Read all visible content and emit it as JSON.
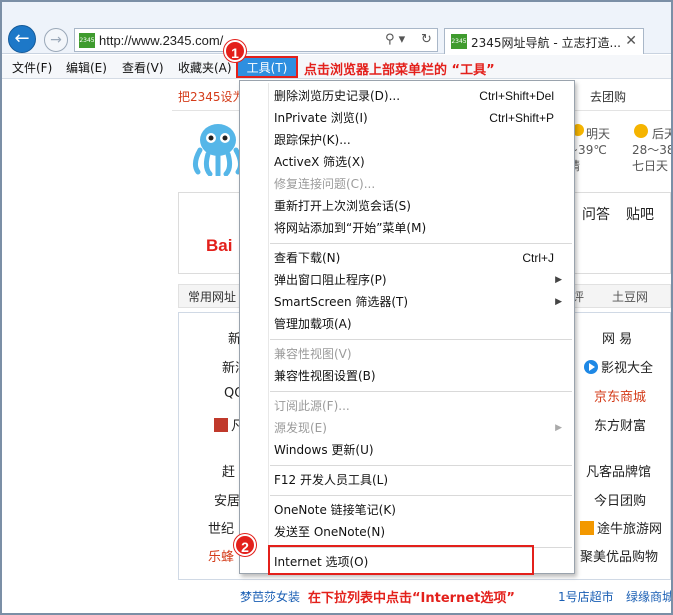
{
  "browser": {
    "url": "http://www.2345.com/",
    "site_icon_text": "2345",
    "url_controls": [
      "⚲ ▾",
      "↻"
    ],
    "tab_title": "2345网址导航 - 立志打造...",
    "tab_close": "✕",
    "back_glyph": "←",
    "forward_glyph": "→"
  },
  "menubar": {
    "file": "文件(F)",
    "edit": "编辑(E)",
    "view": "查看(V)",
    "favorites": "收藏夹(A)",
    "tools": "工具(T)",
    "annotation": "点击浏览器上部菜单栏的 “工具”"
  },
  "badges": {
    "step1": "1",
    "step2": "2"
  },
  "page": {
    "home_link": "把2345设为主页",
    "go_shop": "去团购",
    "weather": {
      "day1": "明天",
      "temp1": "~39℃",
      "cond1": "晴",
      "day2": "后天",
      "temp2": "28～38",
      "cond2": "七日天"
    },
    "baidu": "Bai",
    "search_tabs": {
      "qa": "问答",
      "tieba": "贴吧"
    },
    "category_left": "常用网址",
    "category_right": [
      "评",
      "土豆网"
    ],
    "sites_left": [
      "新",
      "新浪",
      "QQ",
      "凡",
      "赶",
      "安居",
      "世纪",
      "乐蜂"
    ],
    "sites_right": [
      "网 易",
      "影视大全",
      "京东商城",
      "东方财富",
      "凡客品牌馆",
      "今日团购",
      "途牛旅游网",
      "聚美优品购物"
    ],
    "bottom_left": "梦芭莎女装",
    "bottom_annotation": "在下拉列表中点击“Internet选项”",
    "bottom_right": [
      "1号店超市",
      "绿缘商城"
    ]
  },
  "dropdown": {
    "items": [
      {
        "label": "删除浏览历史记录(D)...",
        "shortcut": "Ctrl+Shift+Del",
        "disabled": false
      },
      {
        "label": "InPrivate 浏览(I)",
        "shortcut": "Ctrl+Shift+P",
        "disabled": false
      },
      {
        "label": "跟踪保护(K)...",
        "shortcut": "",
        "disabled": false
      },
      {
        "label": "ActiveX 筛选(X)",
        "shortcut": "",
        "disabled": false
      },
      {
        "label": "修复连接问题(C)...",
        "shortcut": "",
        "disabled": true
      },
      {
        "label": "重新打开上次浏览会话(S)",
        "shortcut": "",
        "disabled": false
      },
      {
        "label": "将网站添加到“开始”菜单(M)",
        "shortcut": "",
        "disabled": false
      },
      {
        "label": "查看下载(N)",
        "shortcut": "Ctrl+J",
        "disabled": false
      },
      {
        "label": "弹出窗口阻止程序(P)",
        "shortcut": "",
        "disabled": false,
        "submenu": true
      },
      {
        "label": "SmartScreen 筛选器(T)",
        "shortcut": "",
        "disabled": false,
        "submenu": true
      },
      {
        "label": "管理加载项(A)",
        "shortcut": "",
        "disabled": false
      },
      {
        "label": "兼容性视图(V)",
        "shortcut": "",
        "disabled": true
      },
      {
        "label": "兼容性视图设置(B)",
        "shortcut": "",
        "disabled": false
      },
      {
        "label": "订阅此源(F)...",
        "shortcut": "",
        "disabled": true
      },
      {
        "label": "源发现(E)",
        "shortcut": "",
        "disabled": true,
        "submenu": true
      },
      {
        "label": "Windows 更新(U)",
        "shortcut": "",
        "disabled": false
      },
      {
        "label": "F12 开发人员工具(L)",
        "shortcut": "",
        "disabled": false
      },
      {
        "label": "OneNote 链接笔记(K)",
        "shortcut": "",
        "disabled": false
      },
      {
        "label": "发送至 OneNote(N)",
        "shortcut": "",
        "disabled": false
      },
      {
        "label": "Internet 选项(O)",
        "shortcut": "",
        "disabled": false
      }
    ],
    "submenu_arrow": "▶"
  },
  "colors": {
    "annotation_red": "#e3201b",
    "menu_highlight": "#2e8fe0",
    "back_button": "#1d78c8"
  }
}
